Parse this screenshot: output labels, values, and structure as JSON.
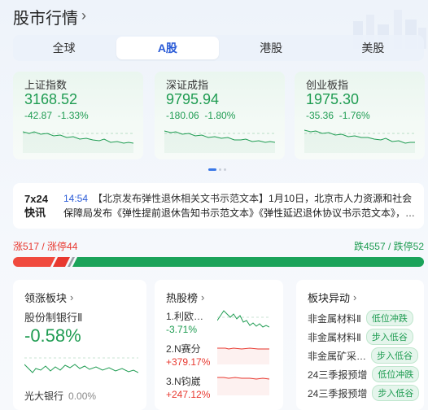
{
  "header": {
    "title": "股市行情"
  },
  "tabs": [
    {
      "label": "全球",
      "active": false
    },
    {
      "label": "A股",
      "active": true
    },
    {
      "label": "港股",
      "active": false
    },
    {
      "label": "美股",
      "active": false
    }
  ],
  "indices": [
    {
      "name": "上证指数",
      "price": "3168.52",
      "change": "-42.87",
      "pct": "-1.33%"
    },
    {
      "name": "深证成指",
      "price": "9795.94",
      "change": "-180.06",
      "pct": "-1.80%"
    },
    {
      "name": "创业板指",
      "price": "1975.30",
      "change": "-35.36",
      "pct": "-1.76%"
    }
  ],
  "news": {
    "badge_line1": "7x24",
    "badge_line2": "快讯",
    "time": "14:54",
    "headline": "【北京发布弹性退休相关文书示范文本】",
    "body": "1月10日，北京市人力资源和社会保障局发布《弹性提前退休告知书示范文本》《弹性延迟退休协议书示范文本》，…"
  },
  "breadth": {
    "up_text": "涨517 / 涨停44",
    "down_text": "跌4557 / 跌停52",
    "up_count": 517,
    "limit_up": 44,
    "down_count": 4557,
    "limit_down": 52
  },
  "leading": {
    "title": "领涨板块",
    "sector": "股份制银行Ⅱ",
    "pct": "-0.58%",
    "leader": "光大银行",
    "leader_pct": "0.00%"
  },
  "hot": {
    "title": "热股榜",
    "items": [
      {
        "name": "1.利欧…",
        "pct": "-3.71%",
        "dir": "neg"
      },
      {
        "name": "2.N赛分",
        "pct": "+379.17%",
        "dir": "pos"
      },
      {
        "name": "3.N钧崴",
        "pct": "+247.12%",
        "dir": "pos"
      }
    ]
  },
  "movement": {
    "title": "板块异动",
    "items": [
      {
        "name": "非金属材料Ⅱ",
        "tag": "低位冲跌"
      },
      {
        "name": "非金属材料Ⅱ",
        "tag": "步入低谷"
      },
      {
        "name": "非金属矿采…",
        "tag": "步入低谷"
      },
      {
        "name": "24三季报预增",
        "tag": "低位冲跌"
      },
      {
        "name": "24三季报预增",
        "tag": "步入低谷"
      }
    ]
  },
  "colors": {
    "up": "#e8382f",
    "down": "#1f9c52",
    "accent": "#2a5bd7"
  }
}
